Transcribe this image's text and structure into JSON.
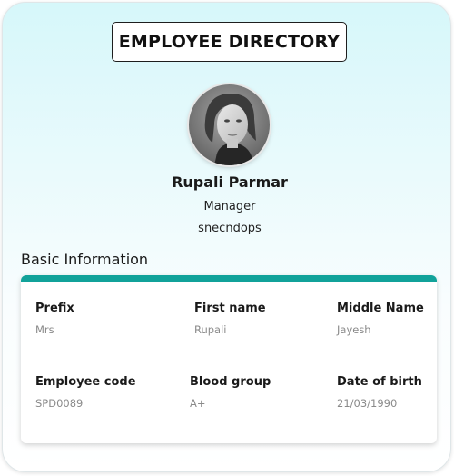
{
  "header": {
    "title": "EMPLOYEE DIRECTORY"
  },
  "profile": {
    "name": "Rupali Parmar",
    "role": "Manager",
    "department": "snecndops",
    "avatar_icon": "person-photo"
  },
  "basic_info": {
    "section_title": "Basic Information",
    "accent_color": "#11a29a",
    "fields": [
      {
        "label": "Prefix",
        "value": "Mrs"
      },
      {
        "label": "First name",
        "value": "Rupali"
      },
      {
        "label": "Middle Name",
        "value": "Jayesh"
      },
      {
        "label": "Employee code",
        "value": "SPD0089"
      },
      {
        "label": "Blood group",
        "value": "A+"
      },
      {
        "label": "Date of birth",
        "value": "21/03/1990"
      }
    ]
  }
}
